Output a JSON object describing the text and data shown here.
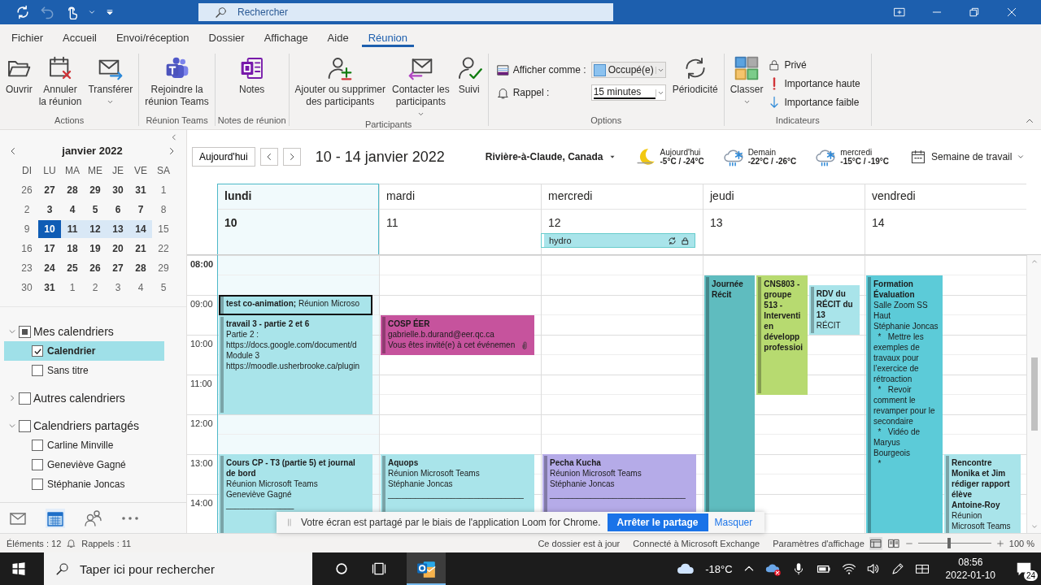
{
  "titlebar": {
    "quick_access": [
      {
        "kind": "sync",
        "disabled": false
      },
      {
        "kind": "undo",
        "disabled": true
      },
      {
        "kind": "touch",
        "disabled": false
      },
      {
        "kind": "customize",
        "disabled": false
      }
    ],
    "search": {
      "placeholder": "Rechercher"
    }
  },
  "menu_tabs": [
    {
      "label": "Fichier",
      "selected": false
    },
    {
      "label": "Accueil",
      "selected": false
    },
    {
      "label": "Envoi/réception",
      "selected": false
    },
    {
      "label": "Dossier",
      "selected": false
    },
    {
      "label": "Affichage",
      "selected": false
    },
    {
      "label": "Aide",
      "selected": false
    },
    {
      "label": "Réunion",
      "selected": true
    }
  ],
  "ribbon": {
    "groups": [
      {
        "label": "Actions",
        "items": [
          {
            "kind": "large",
            "lines": [
              "Ouvrir"
            ],
            "dropdown": false
          },
          {
            "kind": "large",
            "lines": [
              "Annuler",
              "la réunion"
            ],
            "dropdown": false
          },
          {
            "kind": "large",
            "lines": [
              "Transférer"
            ],
            "dropdown": true
          }
        ]
      },
      {
        "label": "Réunion Teams",
        "items": [
          {
            "kind": "large",
            "lines": [
              "Rejoindre la",
              "réunion Teams"
            ],
            "dropdown": false
          }
        ]
      },
      {
        "label": "Notes de réunion",
        "items": [
          {
            "kind": "large",
            "lines": [
              "Notes"
            ],
            "dropdown": false
          }
        ]
      },
      {
        "label": "Participants",
        "items": [
          {
            "kind": "large",
            "lines": [
              "Ajouter ou supprimer",
              "des participants"
            ],
            "dropdown": false
          },
          {
            "kind": "large",
            "lines": [
              "Contacter les",
              "participants"
            ],
            "dropdown": true
          },
          {
            "kind": "large",
            "lines": [
              "Suivi"
            ],
            "dropdown": false
          }
        ]
      },
      {
        "label": "Options",
        "items": [
          {
            "kind": "fields",
            "rows": [
              {
                "label": "Afficher comme :",
                "value": "Occupé(e)",
                "swatch": true
              },
              {
                "label": "Rappel :",
                "value": "15 minutes",
                "swatch": false
              }
            ]
          },
          {
            "kind": "large",
            "lines": [
              "Périodicité"
            ],
            "dropdown": false
          }
        ]
      },
      {
        "label": "Indicateurs",
        "items": [
          {
            "kind": "large",
            "lines": [
              "Classer"
            ],
            "dropdown": true
          },
          {
            "kind": "smalls",
            "rows": [
              {
                "label": "Privé"
              },
              {
                "label": "Importance haute"
              },
              {
                "label": "Importance faible"
              }
            ]
          }
        ]
      }
    ]
  },
  "mini_calendar": {
    "title": "janvier 2022",
    "weekdays": [
      "DI",
      "LU",
      "MA",
      "ME",
      "JE",
      "VE",
      "SA"
    ],
    "weeks": [
      [
        {
          "d": "26",
          "bold": false,
          "selected": false,
          "today": false
        },
        {
          "d": "27",
          "bold": true,
          "selected": false,
          "today": false
        },
        {
          "d": "28",
          "bold": true,
          "selected": false,
          "today": false
        },
        {
          "d": "29",
          "bold": true,
          "selected": false,
          "today": false
        },
        {
          "d": "30",
          "bold": true,
          "selected": false,
          "today": false
        },
        {
          "d": "31",
          "bold": true,
          "selected": false,
          "today": false
        },
        {
          "d": "1",
          "bold": false,
          "selected": false,
          "today": false
        }
      ],
      [
        {
          "d": "2",
          "bold": false,
          "selected": false,
          "today": false
        },
        {
          "d": "3",
          "bold": true,
          "selected": false,
          "today": false
        },
        {
          "d": "4",
          "bold": true,
          "selected": false,
          "today": false
        },
        {
          "d": "5",
          "bold": true,
          "selected": false,
          "today": false
        },
        {
          "d": "6",
          "bold": true,
          "selected": false,
          "today": false
        },
        {
          "d": "7",
          "bold": true,
          "selected": false,
          "today": false
        },
        {
          "d": "8",
          "bold": false,
          "selected": false,
          "today": false
        }
      ],
      [
        {
          "d": "9",
          "bold": false,
          "selected": false,
          "today": false
        },
        {
          "d": "10",
          "bold": true,
          "selected": true,
          "today": true
        },
        {
          "d": "11",
          "bold": true,
          "selected": true,
          "today": false
        },
        {
          "d": "12",
          "bold": true,
          "selected": true,
          "today": false
        },
        {
          "d": "13",
          "bold": true,
          "selected": true,
          "today": false
        },
        {
          "d": "14",
          "bold": true,
          "selected": true,
          "today": false
        },
        {
          "d": "15",
          "bold": false,
          "selected": false,
          "today": false
        }
      ],
      [
        {
          "d": "16",
          "bold": false,
          "selected": false,
          "today": false
        },
        {
          "d": "17",
          "bold": true,
          "selected": false,
          "today": false
        },
        {
          "d": "18",
          "bold": true,
          "selected": false,
          "today": false
        },
        {
          "d": "19",
          "bold": true,
          "selected": false,
          "today": false
        },
        {
          "d": "20",
          "bold": true,
          "selected": false,
          "today": false
        },
        {
          "d": "21",
          "bold": true,
          "selected": false,
          "today": false
        },
        {
          "d": "22",
          "bold": false,
          "selected": false,
          "today": false
        }
      ],
      [
        {
          "d": "23",
          "bold": false,
          "selected": false,
          "today": false
        },
        {
          "d": "24",
          "bold": true,
          "selected": false,
          "today": false
        },
        {
          "d": "25",
          "bold": true,
          "selected": false,
          "today": false
        },
        {
          "d": "26",
          "bold": true,
          "selected": false,
          "today": false
        },
        {
          "d": "27",
          "bold": true,
          "selected": false,
          "today": false
        },
        {
          "d": "28",
          "bold": true,
          "selected": false,
          "today": false
        },
        {
          "d": "29",
          "bold": false,
          "selected": false,
          "today": false
        }
      ],
      [
        {
          "d": "30",
          "bold": false,
          "selected": false,
          "today": false
        },
        {
          "d": "31",
          "bold": true,
          "selected": false,
          "today": false
        },
        {
          "d": "1",
          "bold": false,
          "selected": false,
          "today": false
        },
        {
          "d": "2",
          "bold": false,
          "selected": false,
          "today": false
        },
        {
          "d": "3",
          "bold": false,
          "selected": false,
          "today": false
        },
        {
          "d": "4",
          "bold": false,
          "selected": false,
          "today": false
        },
        {
          "d": "5",
          "bold": false,
          "selected": false,
          "today": false
        }
      ]
    ]
  },
  "calendar_groups": [
    {
      "label": "Mes calendriers",
      "expanded": true,
      "partial": true,
      "items": [
        {
          "label": "Calendrier",
          "checked": true,
          "selected": true
        },
        {
          "label": "Sans titre",
          "checked": false,
          "selected": false
        }
      ]
    },
    {
      "label": "Autres calendriers",
      "expanded": false,
      "partial": false
    },
    {
      "label": "Calendriers partagés",
      "expanded": true,
      "partial": false,
      "items": [
        {
          "label": "Carline Minville",
          "checked": false,
          "selected": false
        },
        {
          "label": "Geneviève Gagné",
          "checked": false,
          "selected": false
        },
        {
          "label": "Stéphanie Joncas",
          "checked": false,
          "selected": false
        }
      ]
    }
  ],
  "nav": [
    {
      "kind": "mail",
      "selected": false
    },
    {
      "kind": "calendar",
      "selected": true
    },
    {
      "kind": "people",
      "selected": false
    },
    {
      "kind": "more",
      "selected": false
    }
  ],
  "toolbar": {
    "today_button": "Aujourd'hui",
    "range": "10 - 14 janvier 2022",
    "location": "Rivière-à-Claude, Canada",
    "weather": [
      {
        "kind": "moon",
        "label": "Aujourd'hui",
        "temps": "-5°C / -24°C"
      },
      {
        "kind": "snow",
        "label": "Demain",
        "temps": "-22°C / -26°C"
      },
      {
        "kind": "snow",
        "label": "mercredi",
        "temps": "-15°C / -19°C"
      }
    ],
    "view": "Semaine de travail"
  },
  "hours": [
    {
      "label": "08:00",
      "bold": true
    },
    {
      "label": "09:00",
      "bold": false
    },
    {
      "label": "10:00",
      "bold": false
    },
    {
      "label": "11:00",
      "bold": false
    },
    {
      "label": "12:00",
      "bold": false
    },
    {
      "label": "13:00",
      "bold": false
    },
    {
      "label": "14:00",
      "bold": false
    }
  ],
  "days": [
    {
      "name": "lundi",
      "number": "10",
      "selected": true,
      "events": [
        {
          "kind": "inline",
          "title": [
            "test co-animation;"
          ],
          "paragraphs": [
            [
              "Réunion Microso"
            ]
          ],
          "color": "#a9e4ea",
          "selected": true
        },
        {
          "kind": "block",
          "title": [
            "travail 3 - partie 2 et 6"
          ],
          "paragraphs": [
            [
              "Partie 2 :",
              "https://docs.google.com/document/d"
            ],
            [
              "Module 3",
              "https://moodle.usherbrooke.ca/plugin"
            ]
          ],
          "color": "#a9e4ea",
          "selected": false
        },
        {
          "kind": "block",
          "title": [
            "Cours CP - T3 (partie 5) et journal",
            "de bord"
          ],
          "paragraphs": [
            [
              "Réunion Microsoft Teams",
              "Geneviève Gagné",
              "_______________"
            ]
          ],
          "color": "#a9e4ea",
          "selected": false
        }
      ]
    },
    {
      "name": "mardi",
      "number": "11",
      "selected": false,
      "events": [
        {
          "kind": "block",
          "title": [
            "COSP ÉER"
          ],
          "paragraphs": [
            [
              "gabrielle.b.durand@eer.qc.ca",
              "Vous êtes invité(e) à cet événemen"
            ]
          ],
          "color": "#c6539d",
          "selected": false,
          "attachment": true
        },
        {
          "kind": "block",
          "title": [
            "Aquops"
          ],
          "paragraphs": [
            [
              "Réunion Microsoft Teams",
              "Stéphanie Joncas",
              "______________________________"
            ]
          ],
          "color": "#a9e4ea",
          "selected": false
        }
      ]
    },
    {
      "name": "mercredi",
      "number": "12",
      "selected": false,
      "all_day": [
        {
          "title": "hydro",
          "recurring": true,
          "private": true
        }
      ],
      "events": [
        {
          "kind": "block",
          "title": [
            "Pecha Kucha"
          ],
          "paragraphs": [
            [
              "Réunion Microsoft Teams",
              "Stéphanie Joncas",
              "______________________________"
            ]
          ],
          "color": "#b5abe8",
          "selected": false
        }
      ]
    },
    {
      "name": "jeudi",
      "number": "13",
      "selected": false,
      "events": [
        {
          "kind": "block",
          "title": [
            "Journée",
            "Récit"
          ],
          "color": "#5fbcbf",
          "selected": false
        },
        {
          "kind": "block",
          "title": [
            "CNS803 -",
            "groupe",
            "513 -",
            "Interventi",
            "en",
            "développ",
            "professioi"
          ],
          "color": "#b7da70",
          "selected": false
        },
        {
          "kind": "block",
          "title": [
            "RDV du",
            "RÉCIT du",
            "13"
          ],
          "paragraphs": [
            [
              "RÉCIT"
            ]
          ],
          "color": "#a9e4ea",
          "selected": false
        }
      ]
    },
    {
      "name": "vendredi",
      "number": "14",
      "selected": false,
      "events": [
        {
          "kind": "block",
          "title": [
            "Formation",
            "Évaluation"
          ],
          "paragraphs": [
            [
              "Salle Zoom SS",
              "Haut",
              "Stéphanie Joncas",
              "  *   Mettre les",
              "exemples de",
              "travaux pour",
              "l’exercice de",
              "rétroaction",
              "  *   Revoir",
              "comment le",
              "revamper pour le",
              "secondaire",
              "  *   Vidéo de",
              "Maryus",
              "Bourgeois",
              "  *"
            ]
          ],
          "color": "#5ccbd8",
          "selected": false
        },
        {
          "kind": "block",
          "title": [
            "Rencontre",
            "Monika et Jim",
            "rédiger rapport",
            "élève",
            "Antoine-Roy"
          ],
          "paragraphs": [
            [
              "Réunion",
              "Microsoft Teams"
            ]
          ],
          "color": "#a9e4ea",
          "selected": false
        }
      ]
    }
  ],
  "share_banner": {
    "message": "Votre écran est partagé par le biais de l'application Loom for Chrome.",
    "stop_button": "Arrêter le partage",
    "hide_link": "Masquer"
  },
  "status_bar": {
    "items": "Éléments : 12",
    "reminders": "Rappels : 11",
    "sync": "Ce dossier est à jour",
    "connection": "Connecté à Microsoft Exchange",
    "settings": "Paramètres d'affichage",
    "zoom": {
      "level": 0.4,
      "reading": "100 %"
    }
  },
  "taskbar": {
    "search_placeholder": "Taper ici pour rechercher",
    "temperature": "-18°C",
    "time": "08:56",
    "date": "2022-01-10",
    "notifications": "24"
  }
}
